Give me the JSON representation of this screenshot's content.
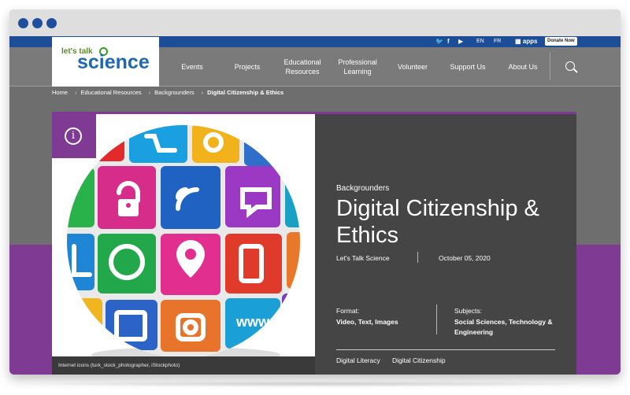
{
  "topbar": {
    "social": [
      "twitter-icon",
      "facebook-icon",
      "youtube-icon"
    ],
    "lang": [
      "EN",
      "FR"
    ],
    "apps_label": "apps",
    "donate_label": "Donate Now"
  },
  "logo": {
    "small": "let's talk",
    "big": "science"
  },
  "nav": [
    {
      "label": "Events"
    },
    {
      "label": "Projects"
    },
    {
      "label": "Educational Resources"
    },
    {
      "label": "Professional Learning"
    },
    {
      "label": "Volunteer"
    },
    {
      "label": "Support Us"
    },
    {
      "label": "About Us"
    }
  ],
  "breadcrumb": [
    "Home",
    "Educational Resources",
    "Backgrounders",
    "Digital Citizenship & Ethics"
  ],
  "hero": {
    "image_credit": "Internet icons (turk_stock_photographer, iStockphoto)",
    "kicker": "Backgrounders",
    "title": "Digital Citizenship & Ethics",
    "author": "Let's Talk Science",
    "date": "October 05, 2020",
    "format_label": "Format:",
    "format_value": "Video, Text, Images",
    "subjects_label": "Subjects:",
    "subjects_value": "Social Sciences, Technology & Engineering",
    "tags": [
      "Digital Literacy",
      "Digital Citizenship"
    ]
  },
  "colors": {
    "brand_blue": "#1d4d96",
    "purple": "#7f3a93",
    "panel": "#454545"
  }
}
